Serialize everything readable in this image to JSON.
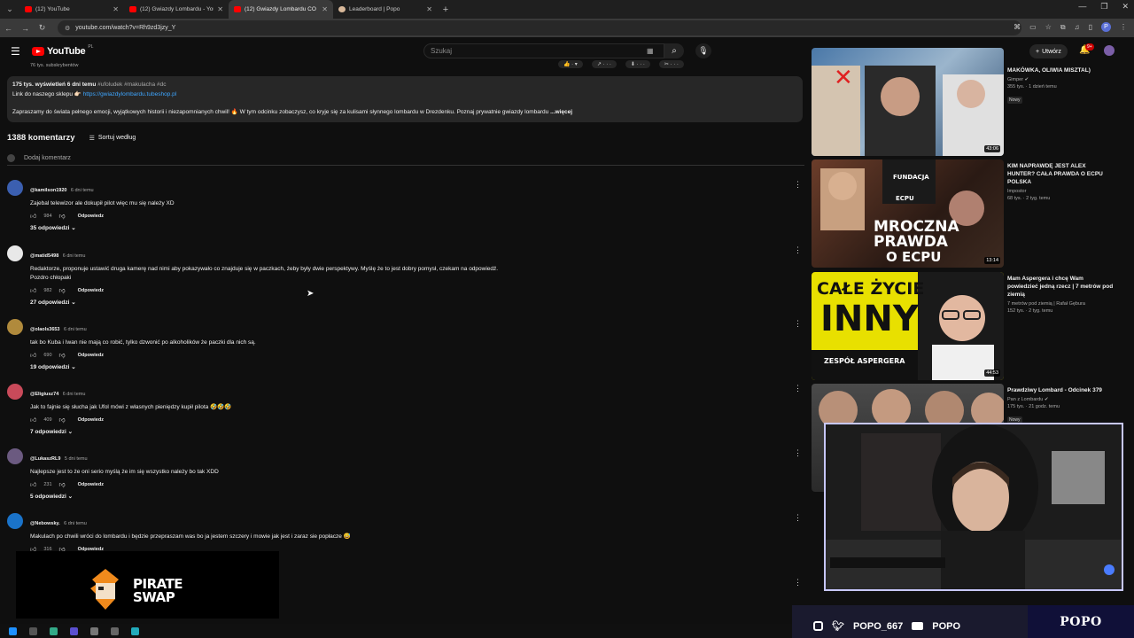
{
  "browser": {
    "tabs": [
      {
        "title": "(12) YouTube",
        "active": false
      },
      {
        "title": "(12) Gwiazdy Lombardu - YouTube",
        "active": false
      },
      {
        "title": "(12) Gwiazdy Lombardu CO DA",
        "active": true
      },
      {
        "title": "Leaderboard | Popo",
        "active": false
      }
    ],
    "url": "youtube.com/watch?v=Rh9zd3jzy_Y"
  },
  "youtube": {
    "logo_text": "YouTube",
    "region": "PL",
    "search_placeholder": "Szukaj",
    "create_label": "Utwórz",
    "notification_count": "9+",
    "channel_subs": "76 tys. subskrybentów"
  },
  "description": {
    "meta": "175 tys. wyświetleń  6 dni temu",
    "tags": "#ufoludek #makulacha #dc",
    "shop_label": "Link do naszego sklepu 👉🏻",
    "shop_link": "https://gwiazdylombardu.tubeshop.pl",
    "text": "Zapraszamy do świata pełnego emocji, wyjątkowych historii i niezapomnianych chwil! 🔥 W tym odcinku zobaczysz, co kryje się za kulisami słynnego lombardu w Drezdenku. Poznaj prywatnie gwiazdy lombardu",
    "more": "...więcej"
  },
  "comments_header": {
    "count": "1388 komentarzy",
    "sort": "Sortuj według",
    "add_placeholder": "Dodaj komentarz"
  },
  "comments": [
    {
      "author": "@kamilson1920",
      "time": "6 dni temu",
      "lines": [
        "Zajebal telewizor ale dokupił pilot więc mu się należy XD"
      ],
      "likes": "984",
      "reply": "Odpowiedz",
      "replies": "35 odpowiedzi",
      "avatar_color": "#3b5fb0"
    },
    {
      "author": "@matid5498",
      "time": "6 dni temu",
      "lines": [
        "Redaktorze, proponuje ustawić druga kamerę nad nimi aby pokazywało co znajduje się w paczkach, żeby były dwie perspektywy. Myślę że to jest dobry pomysł, czekam na odpowiedź.",
        "Pozdro chłopaki"
      ],
      "likes": "982",
      "reply": "Odpowiedz",
      "replies": "27 odpowiedzi",
      "avatar_color": "#e8e8e8"
    },
    {
      "author": "@olaols3653",
      "time": "6 dni temu",
      "lines": [
        "tak bo Kuba i Iwan nie mają co robić, tylko dzwonić po alkoholików że paczki dla nich są."
      ],
      "likes": "690",
      "reply": "Odpowiedz",
      "replies": "19 odpowiedzi",
      "avatar_color": "#b08a3c"
    },
    {
      "author": "@Eligiusz74",
      "time": "6 dni temu",
      "lines": [
        "Jak to fajnie się słucha jak Ufol mówi z własnych pieniędzy kupił pilota 🤣🤣🤣"
      ],
      "likes": "409",
      "reply": "Odpowiedz",
      "replies": "7 odpowiedzi",
      "avatar_color": "#c94a5a"
    },
    {
      "author": "@LukaszRL9",
      "time": "5 dni temu",
      "lines": [
        "Najlepsze jest to że oni serio myślą że im się wszystko należy bo tak XDD"
      ],
      "likes": "231",
      "reply": "Odpowiedz",
      "replies": "5 odpowiedzi",
      "avatar_color": "#6b5a80"
    },
    {
      "author": "@Nebowsky.",
      "time": "6 dni temu",
      "lines": [
        "Makulach po chwili wróci do lombardu i będzie przepraszam was bo ja jestem szczery i mowie jak jest i zaraz sie popłacze 😅"
      ],
      "likes": "316",
      "reply": "Odpowiedz",
      "replies": "",
      "avatar_color": "#1a73c9"
    }
  ],
  "recommendations": [
    {
      "title": "MAKÓWKA, OLIWIA MISZTAL)",
      "channel": "Gimper ✔",
      "meta": "355 tys. · 1 dzień temu",
      "badge": "Nowy",
      "duration": "43:06",
      "thumb_color": "#5a8ab8"
    },
    {
      "title": "KIM NAPRAWDĘ JEST ALEX HUNTER? CAŁA PRAWDA O ECPU POLSKA",
      "channel": "Impostor",
      "meta": "68 tys. · 2 tyg. temu",
      "badge": "",
      "duration": "13:14",
      "thumb_color": "#6b3d2a",
      "thumb_text_1": "MROCZNA",
      "thumb_text_2": "PRAWDA",
      "thumb_text_3": "O ECPU"
    },
    {
      "title": "Mam Aspergera i chcę Wam powiedzieć jedną rzecz | 7 metrów pod ziemią",
      "channel": "7 metrów pod ziemią | Rafał Gębura",
      "meta": "152 tys. · 2 tyg. temu",
      "badge": "",
      "duration": "44:53",
      "thumb_color": "#e8e000",
      "thumb_text_1": "CAŁE ŻYCIE",
      "thumb_text_2": "INNY",
      "thumb_text_3": "ZESPÓŁ ASPERGERA"
    },
    {
      "title": "Prawdziwy Lombard - Odcinek 379",
      "channel": "Pan z Lombardu ✔",
      "meta": "175 tys. · 21 godz. temu",
      "badge": "Nowy",
      "duration": "",
      "thumb_color": "#3a3a3a"
    }
  ],
  "stream_overlay": {
    "instagram": "POPO_667",
    "youtube": "POPO",
    "brand": "POPO"
  },
  "sponsor": {
    "line1": "PIRATE",
    "line2": "SWAP"
  },
  "colors": {
    "background": "#0f0f0f",
    "yt_red": "#ff0000",
    "link_blue": "#3ea6ff",
    "webcam_border": "#c7c7ff"
  }
}
